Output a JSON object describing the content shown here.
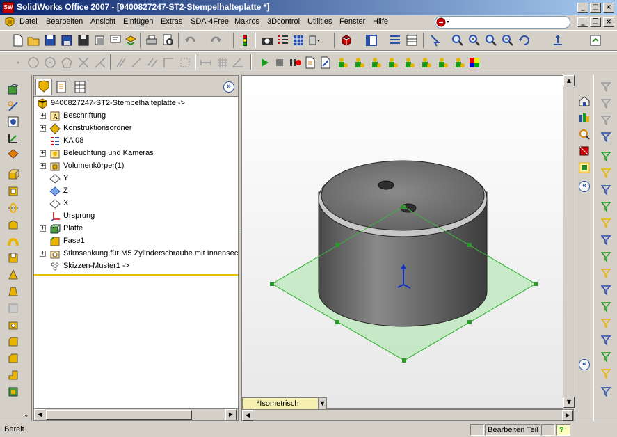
{
  "window": {
    "title": "SolidWorks Office 2007 - [9400827247-ST2-Stempelhalteplatte *]",
    "app_icon_text": "SW",
    "controls": {
      "minimize": "_",
      "maximize": "□",
      "close": "×"
    },
    "doc_controls": {
      "minimize": "_",
      "restore": "❐",
      "close": "×"
    }
  },
  "menu": {
    "items": [
      "Datei",
      "Bearbeiten",
      "Ansicht",
      "Einfügen",
      "Extras",
      "SDA-4Free",
      "Makros",
      "3Dcontrol",
      "Utilities",
      "Fenster",
      "Hilfe"
    ],
    "search_placeholder": ""
  },
  "feature_tree": {
    "root": "9400827247-ST2-Stempelhalteplatte ->",
    "collapse_label": "»",
    "items": [
      {
        "label": "Beschriftung",
        "expandable": true,
        "icon": "annotation-icon"
      },
      {
        "label": "Konstruktionsordner",
        "expandable": true,
        "icon": "design-binder-icon"
      },
      {
        "label": "KA 08",
        "expandable": false,
        "icon": "material-icon"
      },
      {
        "label": "Beleuchtung und Kameras",
        "expandable": true,
        "icon": "lights-icon"
      },
      {
        "label": "Volumenkörper(1)",
        "expandable": true,
        "icon": "solid-bodies-icon"
      },
      {
        "label": "Y",
        "expandable": false,
        "icon": "plane-icon"
      },
      {
        "label": "Z",
        "expandable": false,
        "icon": "plane-icon-selected"
      },
      {
        "label": "X",
        "expandable": false,
        "icon": "plane-icon"
      },
      {
        "label": "Ursprung",
        "expandable": false,
        "icon": "origin-icon"
      },
      {
        "label": "Platte",
        "expandable": true,
        "icon": "extrude-icon"
      },
      {
        "label": "Fase1",
        "expandable": false,
        "icon": "chamfer-icon"
      },
      {
        "label": "Stirnsenkung für M5 Zylinderschraube mit Innensec",
        "expandable": true,
        "icon": "hole-wizard-icon"
      },
      {
        "label": "Skizzen-Muster1 ->",
        "expandable": false,
        "icon": "sketch-pattern-icon"
      }
    ]
  },
  "viewport": {
    "view_orientation": "*Isometrisch"
  },
  "status": {
    "left": "Bereit",
    "mode": "Bearbeiten Teil",
    "help": "?"
  },
  "colors": {
    "title_start": "#0a246a",
    "title_end": "#a6caf0",
    "plane_fill": "#a8e6a8",
    "plane_stroke": "#3cb43c",
    "part_body": "#6e6e6e"
  }
}
